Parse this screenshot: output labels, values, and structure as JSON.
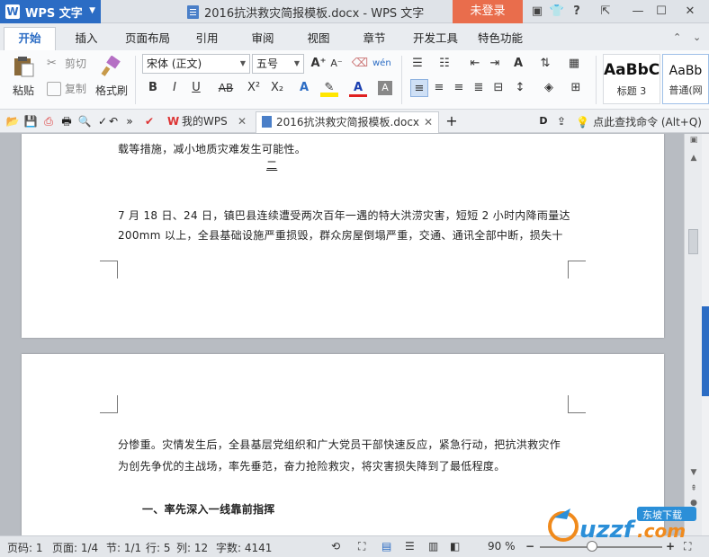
{
  "titlebar": {
    "app_name": "WPS 文字",
    "app_logo": "W",
    "doc_title": "2016抗洪救灾简报模板.docx - WPS 文字",
    "login": "未登录",
    "help": "?"
  },
  "menu": {
    "tabs": [
      "开始",
      "插入",
      "页面布局",
      "引用",
      "审阅",
      "视图",
      "章节",
      "开发工具",
      "特色功能"
    ]
  },
  "ribbon": {
    "paste": "粘贴",
    "cut": "剪切",
    "copy": "复制",
    "format_painter": "格式刷",
    "font_name": "宋体 (正文)",
    "font_size": "五号",
    "bold": "B",
    "italic": "I",
    "underline": "U",
    "strike": "AB",
    "superscript": "X²",
    "subscript": "X₂",
    "styles": [
      {
        "sample": "AaBbC",
        "label": "标题 3"
      },
      {
        "sample": "AaBb",
        "label": "普通(网"
      }
    ]
  },
  "doc_tabs": [
    {
      "label": "我的WPS",
      "active": false
    },
    {
      "label": "2016抗洪救灾简报模板.docx",
      "active": true
    }
  ],
  "search_command": "点此查找命令 (Alt+Q)",
  "document": {
    "page1": {
      "line1": "载等措施，减小地质灾难发生可能性。",
      "page_number": "二",
      "line2": "7 月 18 日、24 日，镇巴县连续遭受两次百年一遇的特大洪涝灾害，短短 2 小时内降雨量达",
      "line3": "200mm 以上，全县基础设施严重损毁，群众房屋倒塌严重，交通、通讯全部中断，损失十"
    },
    "page2": {
      "line1": "分惨重。灾情发生后，全县基层党组织和广大党员干部快速反应，紧急行动，把抗洪救灾作",
      "line2": "为创先争优的主战场，率先垂范，奋力抢险救灾，将灾害损失降到了最低程度。",
      "heading": "一、率先深入一线靠前指挥"
    }
  },
  "status": {
    "page_no": "页码: 1",
    "pages": "页面: 1/4",
    "section": "节: 1/1",
    "row": "行: 5",
    "col": "列: 12",
    "words": "字数: 4141",
    "zoom": "90 %",
    "zoom_minus": "−",
    "zoom_plus": "+"
  },
  "watermark": {
    "text": "uzzf.com",
    "sub": "东坡下载"
  },
  "colors": {
    "accent": "#2b6cc4",
    "login": "#e96d4c",
    "watermark_orange": "#f08a1c"
  }
}
